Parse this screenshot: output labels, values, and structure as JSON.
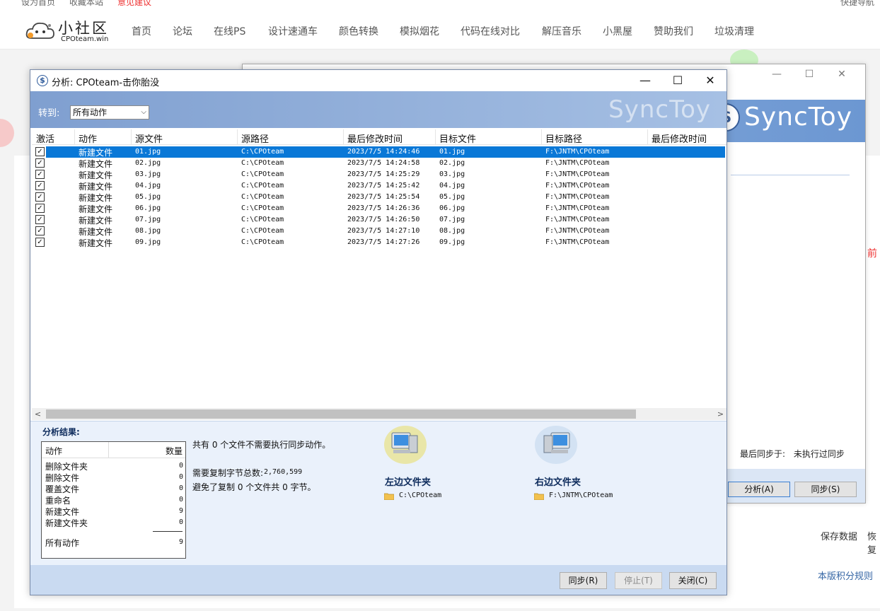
{
  "site": {
    "topbar": {
      "set_home": "设为首页",
      "bookmark": "收藏本站",
      "feedback": "意见建议",
      "quick_nav": "快捷导航"
    },
    "logo": {
      "name": "小社区",
      "sub": "CPOteam.win"
    },
    "nav": [
      "首页",
      "论坛",
      "在线PS",
      "设计速通车",
      "颜色转换",
      "模拟烟花",
      "代码在线对比",
      "解压音乐",
      "小黑屋",
      "赞助我们",
      "垃圾清理"
    ],
    "side_texts": {
      "save_data": "保存数据",
      "restore": "恢复",
      "rules": "本版积分规则",
      "before": "前"
    }
  },
  "back_window": {
    "logo_text": "SyncToy",
    "last_sync_label": "最后同步于:",
    "last_sync_value": "未执行过同步",
    "analyze_button": "分析(A)",
    "sync_button": "同步(S)"
  },
  "dialog": {
    "title": "分析: CPOteam-击你胎没",
    "goto_label": "转到:",
    "goto_value": "所有动作",
    "banner_logo": "SyncToy",
    "columns": [
      "激活",
      "动作",
      "源文件",
      "源路径",
      "最后修改时间",
      "目标文件",
      "目标路径",
      "最后修改时间"
    ],
    "rows": [
      {
        "action": "新建文件",
        "src_file": "01.jpg",
        "src_path": "C:\\CPOteam",
        "modified": "2023/7/5 14:24:46",
        "dst_file": "01.jpg",
        "dst_path": "F:\\JNTM\\CPOteam",
        "dst_modified": ""
      },
      {
        "action": "新建文件",
        "src_file": "02.jpg",
        "src_path": "C:\\CPOteam",
        "modified": "2023/7/5 14:24:58",
        "dst_file": "02.jpg",
        "dst_path": "F:\\JNTM\\CPOteam",
        "dst_modified": ""
      },
      {
        "action": "新建文件",
        "src_file": "03.jpg",
        "src_path": "C:\\CPOteam",
        "modified": "2023/7/5 14:25:29",
        "dst_file": "03.jpg",
        "dst_path": "F:\\JNTM\\CPOteam",
        "dst_modified": ""
      },
      {
        "action": "新建文件",
        "src_file": "04.jpg",
        "src_path": "C:\\CPOteam",
        "modified": "2023/7/5 14:25:42",
        "dst_file": "04.jpg",
        "dst_path": "F:\\JNTM\\CPOteam",
        "dst_modified": ""
      },
      {
        "action": "新建文件",
        "src_file": "05.jpg",
        "src_path": "C:\\CPOteam",
        "modified": "2023/7/5 14:25:54",
        "dst_file": "05.jpg",
        "dst_path": "F:\\JNTM\\CPOteam",
        "dst_modified": ""
      },
      {
        "action": "新建文件",
        "src_file": "06.jpg",
        "src_path": "C:\\CPOteam",
        "modified": "2023/7/5 14:26:36",
        "dst_file": "06.jpg",
        "dst_path": "F:\\JNTM\\CPOteam",
        "dst_modified": ""
      },
      {
        "action": "新建文件",
        "src_file": "07.jpg",
        "src_path": "C:\\CPOteam",
        "modified": "2023/7/5 14:26:50",
        "dst_file": "07.jpg",
        "dst_path": "F:\\JNTM\\CPOteam",
        "dst_modified": ""
      },
      {
        "action": "新建文件",
        "src_file": "08.jpg",
        "src_path": "C:\\CPOteam",
        "modified": "2023/7/5 14:27:10",
        "dst_file": "08.jpg",
        "dst_path": "F:\\JNTM\\CPOteam",
        "dst_modified": ""
      },
      {
        "action": "新建文件",
        "src_file": "09.jpg",
        "src_path": "C:\\CPOteam",
        "modified": "2023/7/5 14:27:26",
        "dst_file": "09.jpg",
        "dst_path": "F:\\JNTM\\CPOteam",
        "dst_modified": ""
      }
    ],
    "results": {
      "title": "分析结果:",
      "head_action": "动作",
      "head_count": "数量",
      "items": [
        {
          "label": "删除文件夹",
          "count": "0"
        },
        {
          "label": "删除文件",
          "count": "0"
        },
        {
          "label": "覆盖文件",
          "count": "0"
        },
        {
          "label": "重命名",
          "count": "0"
        },
        {
          "label": "新建文件",
          "count": "9"
        },
        {
          "label": "新建文件夹",
          "count": "0"
        }
      ],
      "total_label": "所有动作",
      "total_count": "9",
      "no_action_text": "共有 0 个文件不需要执行同步动作。",
      "bytes_label": "需要复制字节总数:",
      "bytes_value": "2,760,599",
      "avoided_text": "避免了复制 0 个文件共 0 字节。",
      "left_folder_label": "左边文件夹",
      "left_folder_path": "C:\\CPOteam",
      "right_folder_label": "右边文件夹",
      "right_folder_path": "F:\\JNTM\\CPOteam"
    },
    "buttons": {
      "sync": "同步(R)",
      "stop": "停止(T)",
      "close": "关闭(C)"
    }
  }
}
